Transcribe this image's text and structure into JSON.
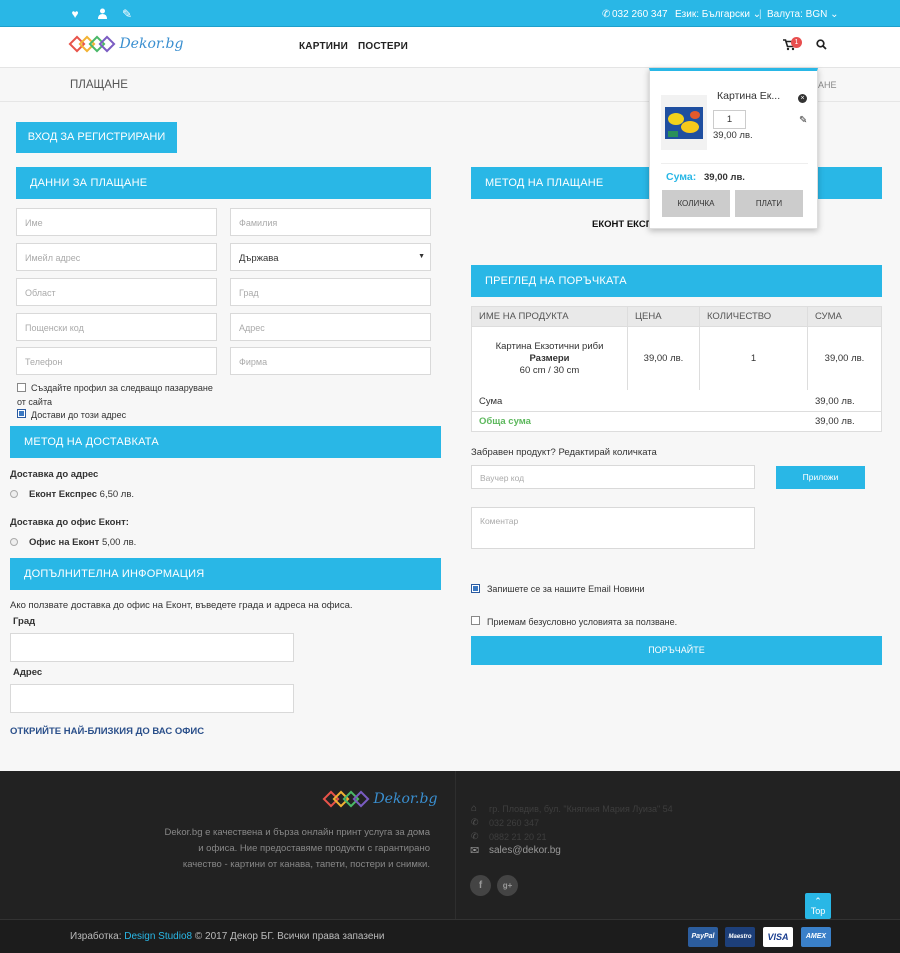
{
  "topbar": {
    "phone": "032 260 347",
    "language_label": "Език: Български",
    "currency_label": "Валута: BGN"
  },
  "brand": {
    "logo_text": "Dekor.bg"
  },
  "nav": {
    "items": [
      "КАРТИНИ",
      "ПОСТЕРИ"
    ],
    "cart_count": "1"
  },
  "page": {
    "title": "ПЛАЩАНЕ",
    "breadcrumb_tail": "АНЕ"
  },
  "login_button": "ВХОД ЗА РЕГИСТРИРАНИ",
  "billing": {
    "heading": "ДАННИ ЗА ПЛАЩАНЕ",
    "placeholders": {
      "first_name": "Име",
      "last_name": "Фамилия",
      "email": "Имейл адрес",
      "country": "Държава",
      "region": "Област",
      "city": "Град",
      "postcode": "Пощенски код",
      "address": "Адрес",
      "phone": "Телефон",
      "company": "Фирма"
    },
    "create_account_line1": "Създайте профил за следващо пазаруване",
    "create_account_line2": "от сайта",
    "ship_here": "Достави до този адрес"
  },
  "shipping": {
    "heading": "МЕТОД НА ДОСТАВКАТА",
    "group1_title": "Доставка до адрес",
    "option1_name": "Еконт Експрес",
    "option1_price": "6,50 лв.",
    "group2_title": "Доставка до офис Еконт:",
    "option2_name": "Офис на Еконт",
    "option2_price": "5,00 лв."
  },
  "extra": {
    "heading": "ДОПЪЛНИТЕЛНА ИНФОРМАЦИЯ",
    "note": "Ако ползвате доставка до офис на Еконт, въведете града и адреса на офиса.",
    "city_label": "Град",
    "address_label": "Адрес",
    "find_office": "ОТКРИЙТЕ НАЙ-БЛИЗКИЯ ДО ВАС ОФИС"
  },
  "payment": {
    "heading": "МЕТОД НА ПЛАЩАНЕ",
    "method_text": "ЕКОНТ ЕКСП"
  },
  "review": {
    "heading": "ПРЕГЛЕД НА ПОРЪЧКАТА",
    "columns": [
      "ИМЕ НА ПРОДУКТА",
      "ЦЕНА",
      "КОЛИЧЕСТВО",
      "СУМА"
    ],
    "product_name": "Картина Екзотични риби",
    "size_label": "Размери",
    "size_value": "60 cm / 30 cm",
    "price": "39,00 лв.",
    "qty": "1",
    "line_total": "39,00 лв.",
    "subtotal_label": "Сума",
    "subtotal_value": "39,00 лв.",
    "total_label": "Обща сума",
    "total_value": "39,00 лв."
  },
  "voucher": {
    "prompt": "Забравен продукт? Редактирай количката",
    "placeholder": "Ваучер код",
    "apply": "Приложи",
    "comment_placeholder": "Коментар"
  },
  "newsletter": "Запишете се за нашите Email Новини",
  "terms": "Приемам безусловно условията за ползване.",
  "order_button": "ПОРЪЧАЙТЕ",
  "cart_dropdown": {
    "item_name": "Картина Ек...",
    "qty": "1",
    "price": "39,00 лв.",
    "sum_label": "Сума:",
    "sum_value": "39,00 лв.",
    "cart_button": "КОЛИЧКА",
    "pay_button": "ПЛАТИ"
  },
  "footer": {
    "about_line1": "Dekor.bg е качествена и бърза онлайн принт услуга за дома",
    "about_line2": "и офиса. Ние предоставяме продукти с гарантирано",
    "about_line3": "качество - картини от канава, тапети, постери и снимки.",
    "address": "гр. Пловдив, бул. \"Княгиня Мария Луиза\" 54",
    "phone1": "032 260 347",
    "phone2": "0882 21 20 21",
    "email": "sales@dekor.bg",
    "top_label": "Top",
    "credit_prefix": "Изработка: ",
    "credit_link": "Design Studio8",
    "copyright": "© 2017 Декор БГ. Всички права запазени",
    "payments": [
      "PayPal",
      "Maestro",
      "VISA",
      "AMEX"
    ]
  }
}
